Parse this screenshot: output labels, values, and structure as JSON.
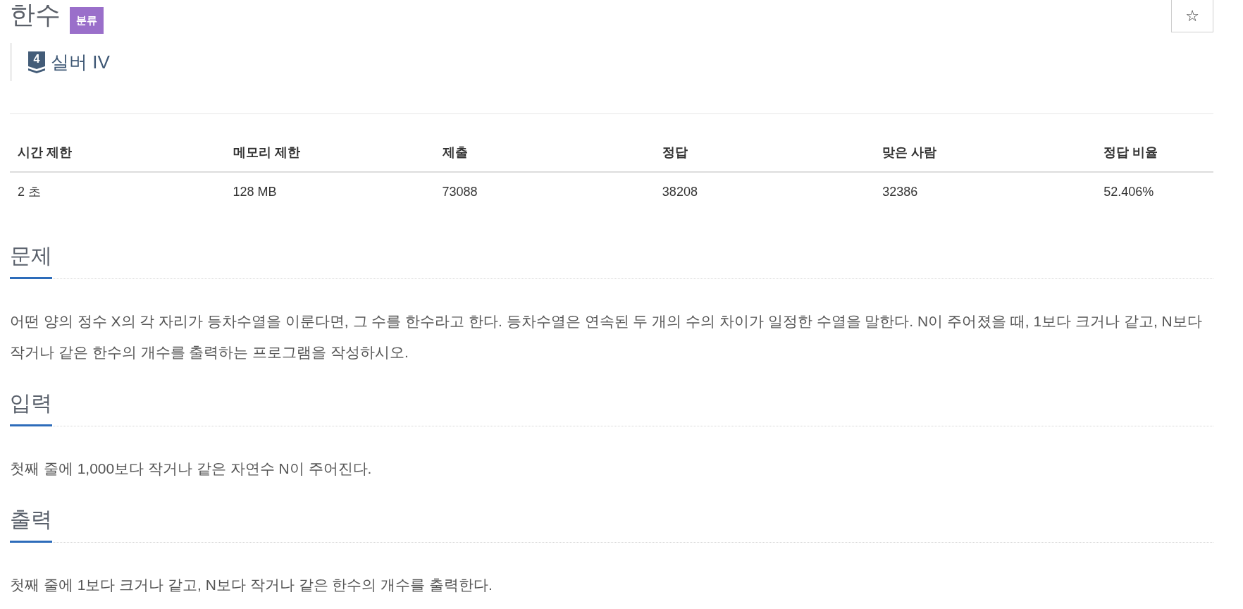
{
  "problem": {
    "title": "한수",
    "category_badge": "분류",
    "favorite_button": "☆"
  },
  "tier": {
    "badge_number": "4",
    "name": "실버 IV"
  },
  "limits_table": {
    "columns": [
      "시간 제한",
      "메모리 제한",
      "제출",
      "정답",
      "맞은 사람",
      "정답 비율"
    ],
    "rows": [
      [
        "2 초",
        "128 MB",
        "73088",
        "38208",
        "32386",
        "52.406%"
      ]
    ]
  },
  "sections": [
    {
      "heading": "문제",
      "body": "어떤 양의 정수 X의 각 자리가 등차수열을 이룬다면, 그 수를 한수라고 한다. 등차수열은 연속된 두 개의 수의 차이가 일정한 수열을 말한다. N이 주어졌을 때, 1보다 크거나 같고, N보다 작거나 같은 한수의 개수를 출력하는 프로그램을 작성하시오."
    },
    {
      "heading": "입력",
      "body": "첫째 줄에 1,000보다 작거나 같은 자연수 N이 주어진다."
    },
    {
      "heading": "출력",
      "body": "첫째 줄에 1보다 크거나 같고, N보다 작거나 같은 한수의 개수를 출력한다."
    }
  ]
}
